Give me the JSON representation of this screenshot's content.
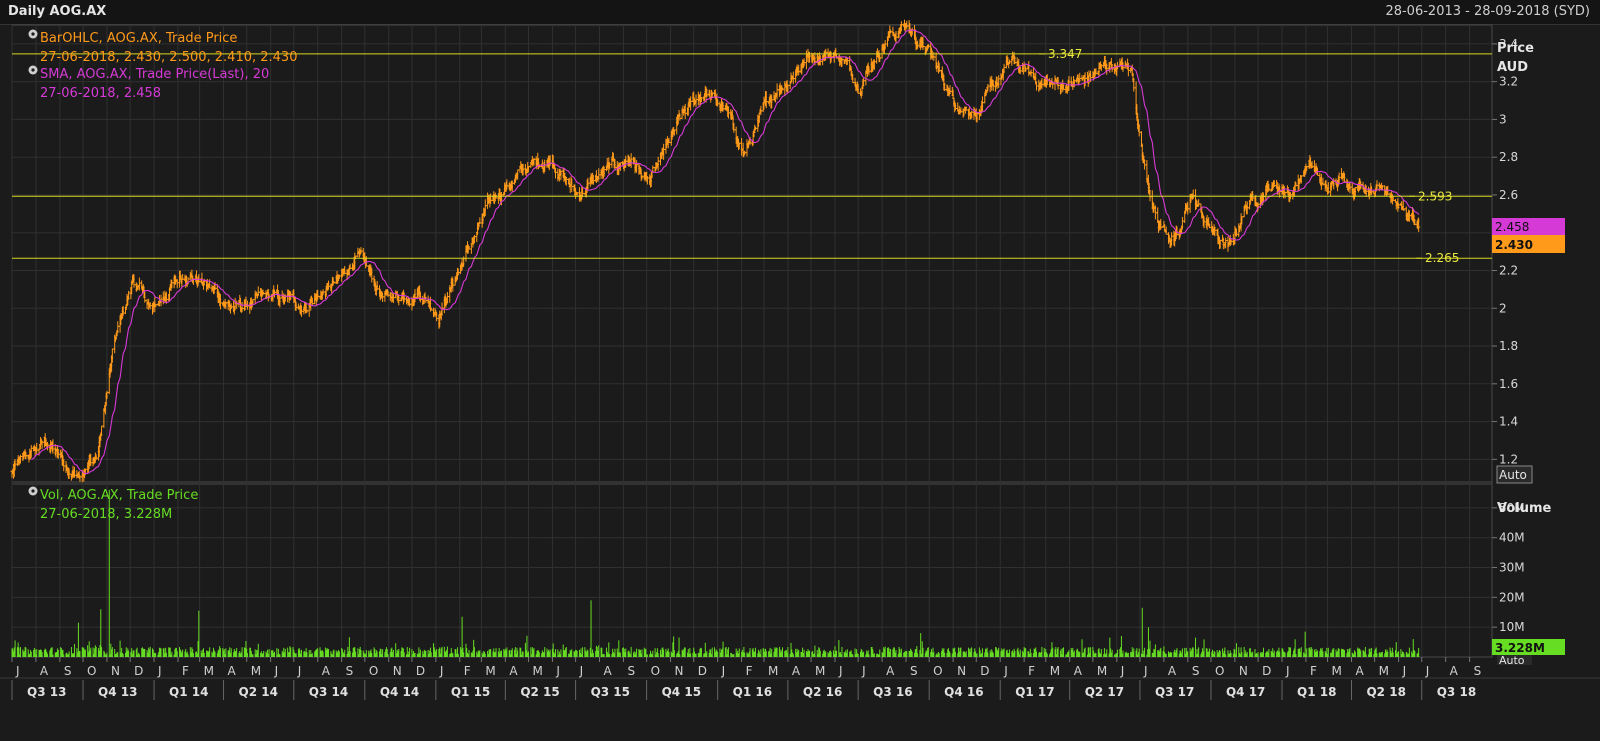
{
  "header": {
    "title": "Daily AOG.AX",
    "date_range": "28-06-2013 - 28-09-2018 (SYD)"
  },
  "price_panel": {
    "axis_title_line1": "Price",
    "axis_title_line2": "AUD",
    "auto_label": "Auto",
    "legend": [
      {
        "icon": "info-icon",
        "text": "BarOHLC, AOG.AX, Trade Price",
        "color": "#ff9a1a"
      },
      {
        "text": "27-06-2018, 2.430, 2.500, 2.410, 2.430",
        "color": "#ff9a1a"
      },
      {
        "icon": "info-icon",
        "text": "SMA, AOG.AX, Trade Price(Last),  20",
        "color": "#d63ad6"
      },
      {
        "text": "27-06-2018, 2.458",
        "color": "#d63ad6"
      }
    ],
    "hlines": [
      {
        "value": 3.347,
        "label": "3.347"
      },
      {
        "value": 2.593,
        "label": "2.593"
      },
      {
        "value": 2.265,
        "label": "2.265"
      }
    ],
    "last_sma_tag": "2.458",
    "last_price_tag": "2.430"
  },
  "volume_panel": {
    "axis_title": "Volume",
    "auto_label": "Auto",
    "legend": [
      {
        "icon": "info-icon",
        "text": "Vol, AOG.AX, Trade Price",
        "color": "#66dd22"
      },
      {
        "text": "27-06-2018, 3.228M",
        "color": "#66dd22"
      }
    ],
    "last_volume_tag": "3.228M"
  },
  "colors": {
    "background": "#1b1b1b",
    "grid": "#303030",
    "price_bars": "#ff9a1a",
    "sma": "#d63ad6",
    "volume": "#66dd22",
    "hline": "#d8d820"
  },
  "chart_data": [
    {
      "type": "line",
      "title": "Daily AOG.AX",
      "ylabel": "Price AUD",
      "ylim": [
        1.08,
        3.5
      ],
      "y_ticks": [
        "1.2",
        "1.4",
        "1.6",
        "1.8",
        "2",
        "2.2",
        "2.4",
        "2.6",
        "2.8",
        "3",
        "3.2",
        "3.4"
      ],
      "month_ticks": [
        "J",
        "A",
        "S",
        "O",
        "N",
        "D",
        "J",
        "F",
        "M",
        "A",
        "M",
        "J",
        "J",
        "A",
        "S",
        "O",
        "N",
        "D",
        "J",
        "F",
        "M",
        "A",
        "M",
        "J",
        "J",
        "A",
        "S",
        "O",
        "N",
        "D",
        "J",
        "F",
        "M",
        "A",
        "M",
        "J",
        "J",
        "A",
        "S",
        "O",
        "N",
        "D",
        "J",
        "F",
        "M",
        "A",
        "M",
        "J",
        "J",
        "A",
        "S",
        "O",
        "N",
        "D",
        "J",
        "F",
        "M",
        "A",
        "M",
        "J",
        "J",
        "A",
        "S"
      ],
      "quarter_ticks": [
        "Q3 13",
        "Q4 13",
        "Q1 14",
        "Q2 14",
        "Q3 14",
        "Q4 14",
        "Q1 15",
        "Q2 15",
        "Q3 15",
        "Q4 15",
        "Q1 16",
        "Q2 16",
        "Q3 16",
        "Q4 16",
        "Q1 17",
        "Q2 17",
        "Q3 17",
        "Q4 17",
        "Q1 18",
        "Q2 18",
        "Q3 18"
      ],
      "series": [
        {
          "style": "ohlc_bars",
          "color": "#ff9a1a",
          "anchors": [
            [
              "2013-07-01",
              1.13
            ],
            [
              "2013-08-15",
              1.3
            ],
            [
              "2013-09-15",
              1.12
            ],
            [
              "2013-10-20",
              1.22
            ],
            [
              "2013-11-10",
              1.8
            ],
            [
              "2013-12-05",
              2.15
            ],
            [
              "2013-12-30",
              1.98
            ],
            [
              "2014-01-20",
              2.1
            ],
            [
              "2014-02-15",
              2.2
            ],
            [
              "2014-03-15",
              2.1
            ],
            [
              "2014-04-15",
              2.0
            ],
            [
              "2014-06-01",
              2.05
            ],
            [
              "2014-07-15",
              2.02
            ],
            [
              "2014-09-01",
              2.15
            ],
            [
              "2014-09-20",
              2.28
            ],
            [
              "2014-10-25",
              2.05
            ],
            [
              "2014-12-10",
              2.1
            ],
            [
              "2015-01-05",
              1.98
            ],
            [
              "2015-02-05",
              2.25
            ],
            [
              "2015-03-01",
              2.45
            ],
            [
              "2015-03-20",
              2.6
            ],
            [
              "2015-05-01",
              2.75
            ],
            [
              "2015-06-01",
              2.8
            ],
            [
              "2015-07-01",
              2.6
            ],
            [
              "2015-08-10",
              2.72
            ],
            [
              "2015-09-10",
              2.8
            ],
            [
              "2015-10-05",
              2.65
            ],
            [
              "2015-11-15",
              3.0
            ],
            [
              "2015-12-15",
              3.15
            ],
            [
              "2016-01-10",
              3.05
            ],
            [
              "2016-02-05",
              2.82
            ],
            [
              "2016-03-15",
              3.15
            ],
            [
              "2016-05-01",
              3.35
            ],
            [
              "2016-06-05",
              3.35
            ],
            [
              "2016-07-01",
              3.2
            ],
            [
              "2016-08-10",
              3.45
            ],
            [
              "2016-09-01",
              3.5
            ],
            [
              "2016-10-01",
              3.35
            ],
            [
              "2016-11-01",
              3.1
            ],
            [
              "2016-12-05",
              3.05
            ],
            [
              "2017-01-15",
              3.3
            ],
            [
              "2017-02-20",
              3.2
            ],
            [
              "2017-03-20",
              3.18
            ],
            [
              "2017-04-20",
              3.2
            ],
            [
              "2017-05-25",
              3.3
            ],
            [
              "2017-06-20",
              3.25
            ],
            [
              "2017-07-05",
              2.8
            ],
            [
              "2017-07-25",
              2.45
            ],
            [
              "2017-08-20",
              2.35
            ],
            [
              "2017-09-05",
              2.6
            ],
            [
              "2017-09-25",
              2.45
            ],
            [
              "2017-10-25",
              2.3
            ],
            [
              "2017-11-15",
              2.55
            ],
            [
              "2017-12-15",
              2.65
            ],
            [
              "2018-01-15",
              2.62
            ],
            [
              "2018-02-05",
              2.78
            ],
            [
              "2018-02-25",
              2.62
            ],
            [
              "2018-03-20",
              2.68
            ],
            [
              "2018-04-20",
              2.65
            ],
            [
              "2018-05-20",
              2.65
            ],
            [
              "2018-06-10",
              2.5
            ],
            [
              "2018-06-27",
              2.43
            ]
          ]
        },
        {
          "name": "SMA 20",
          "style": "line",
          "color": "#d63ad6",
          "window": 20
        }
      ]
    },
    {
      "type": "bar",
      "ylabel": "Volume",
      "ylim": [
        0,
        58
      ],
      "y_ticks": [
        "10M",
        "20M",
        "30M",
        "40M",
        "50M"
      ],
      "base_level_m": 2.0,
      "spikes_m": [
        [
          "2013-09-25",
          11.5
        ],
        [
          "2013-10-24",
          16
        ],
        [
          "2013-11-04",
          56
        ],
        [
          "2013-11-18",
          5.5
        ],
        [
          "2014-02-28",
          15.5
        ],
        [
          "2015-02-04",
          13.5
        ],
        [
          "2015-07-21",
          19
        ],
        [
          "2016-09-20",
          8
        ],
        [
          "2017-07-04",
          16.5
        ],
        [
          "2017-07-12",
          10
        ],
        [
          "2017-08-20",
          9
        ],
        [
          "2018-01-31",
          8.5
        ],
        [
          "2018-06-20",
          6
        ]
      ]
    }
  ]
}
